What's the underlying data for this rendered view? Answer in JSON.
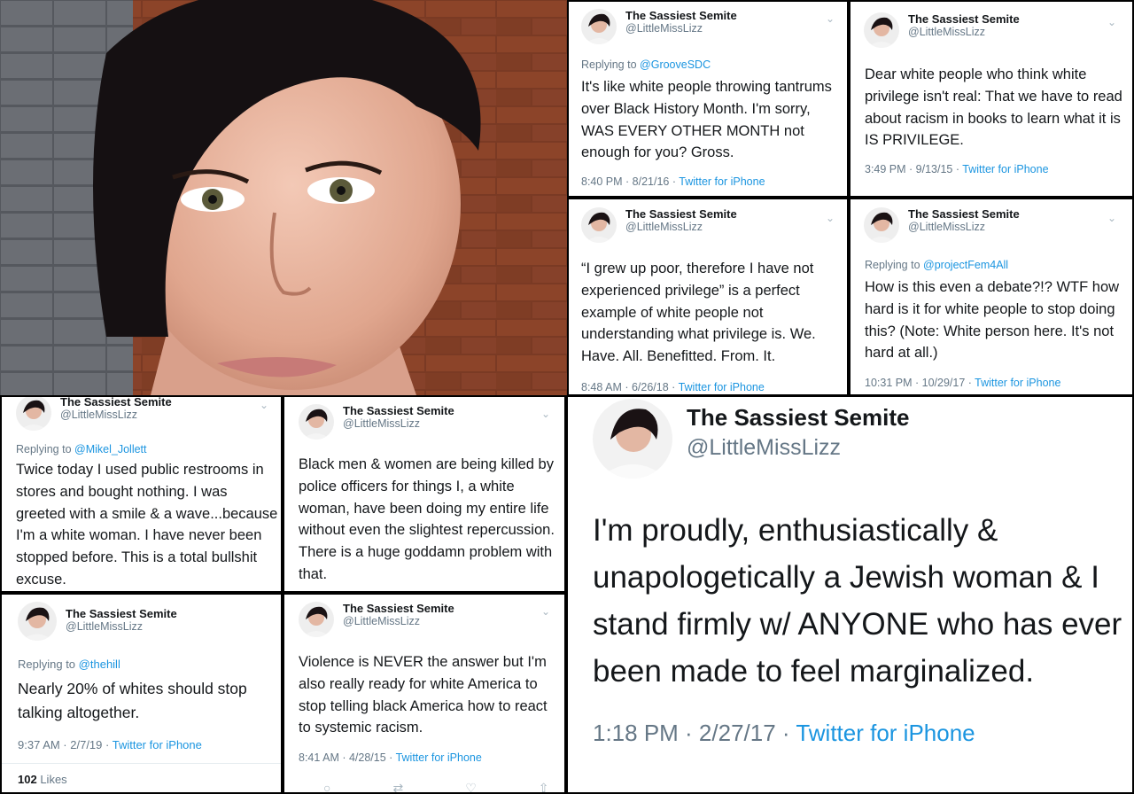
{
  "colors": {
    "link": "#1b95e0",
    "secondary": "#657786",
    "text": "#14171a",
    "brick": "#7a3a24"
  },
  "tweets": [
    {
      "name": "The Sassiest Semite",
      "handle": "@LittleMissLizz",
      "reply_prefix": "Replying to",
      "reply_to": "@GrooveSDC",
      "lines": [
        "It's like white people throwing tantrums",
        "over Black History Month. I'm sorry,",
        "WAS EVERY OTHER MONTH not",
        "enough for you? Gross."
      ],
      "time": "8:40 PM · 8/21/16 · ",
      "source": "Twitter for iPhone"
    },
    {
      "name": "The Sassiest Semite",
      "handle": "@LittleMissLizz",
      "lines": [
        "Dear white people who think white",
        "privilege isn't real: That we have to read",
        "about racism in books to learn what it is",
        "IS PRIVILEGE."
      ],
      "time": "3:49 PM · 9/13/15 · ",
      "source": "Twitter for iPhone"
    },
    {
      "name": "The Sassiest Semite",
      "handle": "@LittleMissLizz",
      "lines": [
        "“I grew up poor, therefore I have not",
        "experienced privilege” is a perfect",
        "example of white people not",
        "understanding what privilege is. We.",
        "Have. All. Benefitted. From. It."
      ],
      "time": "8:48 AM · 6/26/18 · ",
      "source": "Twitter for iPhone"
    },
    {
      "name": "The Sassiest Semite",
      "handle": "@LittleMissLizz",
      "reply_prefix": "Replying to",
      "reply_to": "@projectFem4All",
      "lines": [
        "How is this even a debate?!? WTF how",
        "hard is it for white people to stop doing",
        "this? (Note: White person here. It's not",
        "hard at all.)"
      ],
      "time": "10:31 PM · 10/29/17 · ",
      "source": "Twitter for iPhone"
    },
    {
      "name": "The Sassiest Semite",
      "handle": "@LittleMissLizz",
      "reply_prefix": "Replying to",
      "reply_to": "@Mikel_Jollett",
      "lines": [
        "Twice today I used public restrooms in",
        "stores and bought nothing. I was",
        "greeted with a smile & a wave...because",
        "I'm a white woman. I have never been",
        "stopped before. This is a total bullshit",
        "excuse."
      ]
    },
    {
      "name": "The Sassiest Semite",
      "handle": "@LittleMissLizz",
      "lines": [
        "Black men & women are being killed by",
        "police officers for things I, a white",
        "woman, have been doing my entire life",
        "without even the slightest repercussion.",
        "There is a huge goddamn problem with",
        "that."
      ]
    },
    {
      "name": "The Sassiest Semite",
      "handle": "@LittleMissLizz",
      "reply_prefix": "Replying to",
      "reply_to": "@thehill",
      "lines": [
        "Nearly 20% of whites should stop",
        "talking altogether."
      ],
      "time": "9:37 AM · 2/7/19 · ",
      "source": "Twitter for iPhone",
      "likes_count": "102",
      "likes_label": "Likes"
    },
    {
      "name": "The Sassiest Semite",
      "handle": "@LittleMissLizz",
      "lines": [
        "Violence is NEVER the answer but I'm",
        "also really ready for white America to",
        "stop telling black America how to react",
        "to systemic racism."
      ],
      "time": "8:41 AM · 4/28/15 · ",
      "source": "Twitter for iPhone"
    },
    {
      "name": "The Sassiest Semite",
      "handle": "@LittleMissLizz",
      "lines": [
        "I'm proudly, enthusiastically &",
        "unapologetically a Jewish woman & I",
        "stand firmly w/ ANYONE who has ever",
        "been made to feel marginalized."
      ],
      "time": "1:18 PM · 2/27/17 · ",
      "source": "Twitter for iPhone"
    }
  ]
}
